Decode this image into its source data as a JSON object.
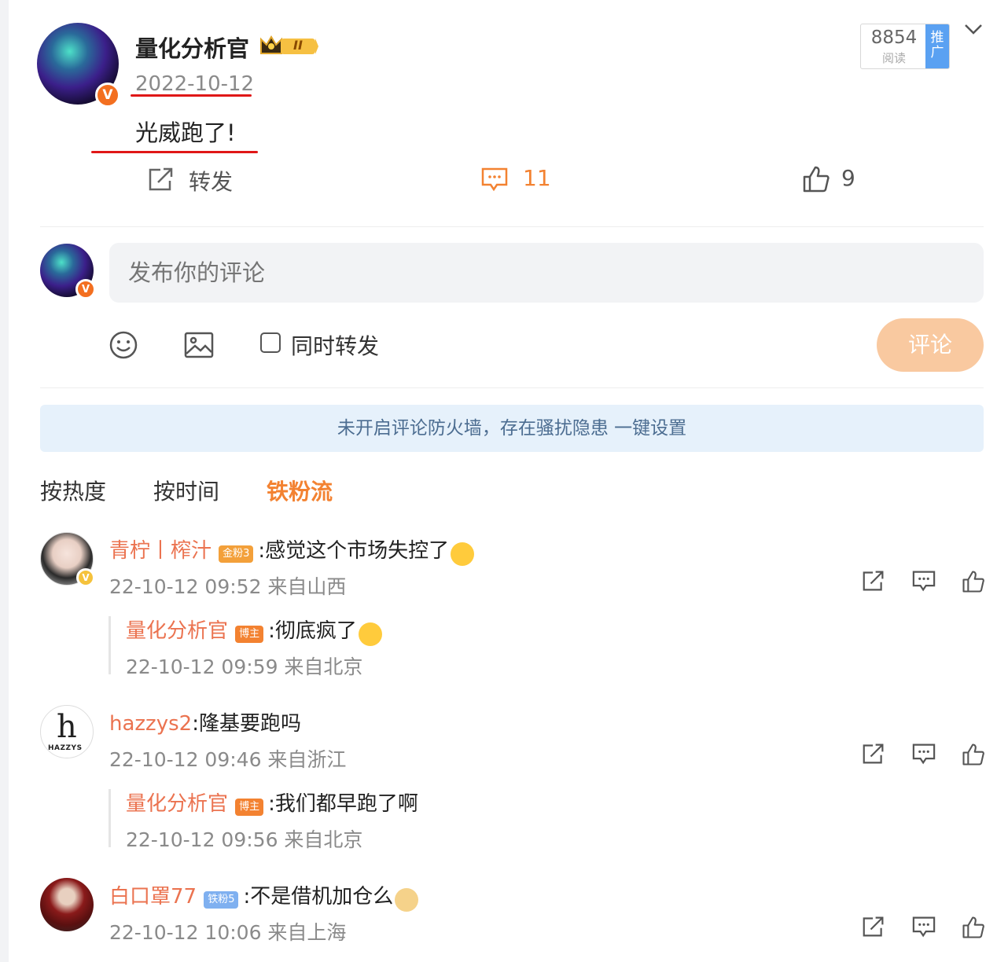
{
  "post": {
    "author": "量化分析官",
    "level_badge": "II",
    "date": "2022-10-12",
    "content": "光威跑了!",
    "read_count": "8854",
    "read_label": "阅读",
    "promote_label": "推广",
    "repost_label": "转发",
    "comment_count": "11",
    "like_count": "9"
  },
  "composer": {
    "placeholder": "发布你的评论",
    "repost_option": "同时转发",
    "submit_label": "评论"
  },
  "notice": "未开启评论防火墙，存在骚扰隐患 一键设置",
  "sort_tabs": [
    {
      "label": "按热度",
      "active": false
    },
    {
      "label": "按时间",
      "active": false
    },
    {
      "label": "铁粉流",
      "active": true
    }
  ],
  "comments": [
    {
      "user": "青柠丨榨汁",
      "badge": "金粉3",
      "text": ":感觉这个市场失控了",
      "time": "22-10-12 09:52 来自山西",
      "reply": {
        "user": "量化分析官",
        "badge": "博主",
        "text": ":彻底疯了",
        "time": "22-10-12 09:59 来自北京"
      }
    },
    {
      "user": "hazzys2",
      "text": ":隆基要跑吗",
      "time": "22-10-12 09:46 来自浙江",
      "avatar_text": "HAZZYS",
      "reply": {
        "user": "量化分析官",
        "badge": "博主",
        "text": ":我们都早跑了啊",
        "time": "22-10-12 09:56 来自北京"
      }
    },
    {
      "user": "白口罩77",
      "badge": "铁粉5",
      "text": ":不是借机加仓么",
      "time": "22-10-12 10:06 来自上海"
    }
  ],
  "colors": {
    "accent_orange": "#f38231",
    "username_orange": "#eb7350",
    "annotation_red": "#e01717",
    "notice_bg": "#e6f1fb",
    "promo_blue": "#5aa1f2"
  }
}
